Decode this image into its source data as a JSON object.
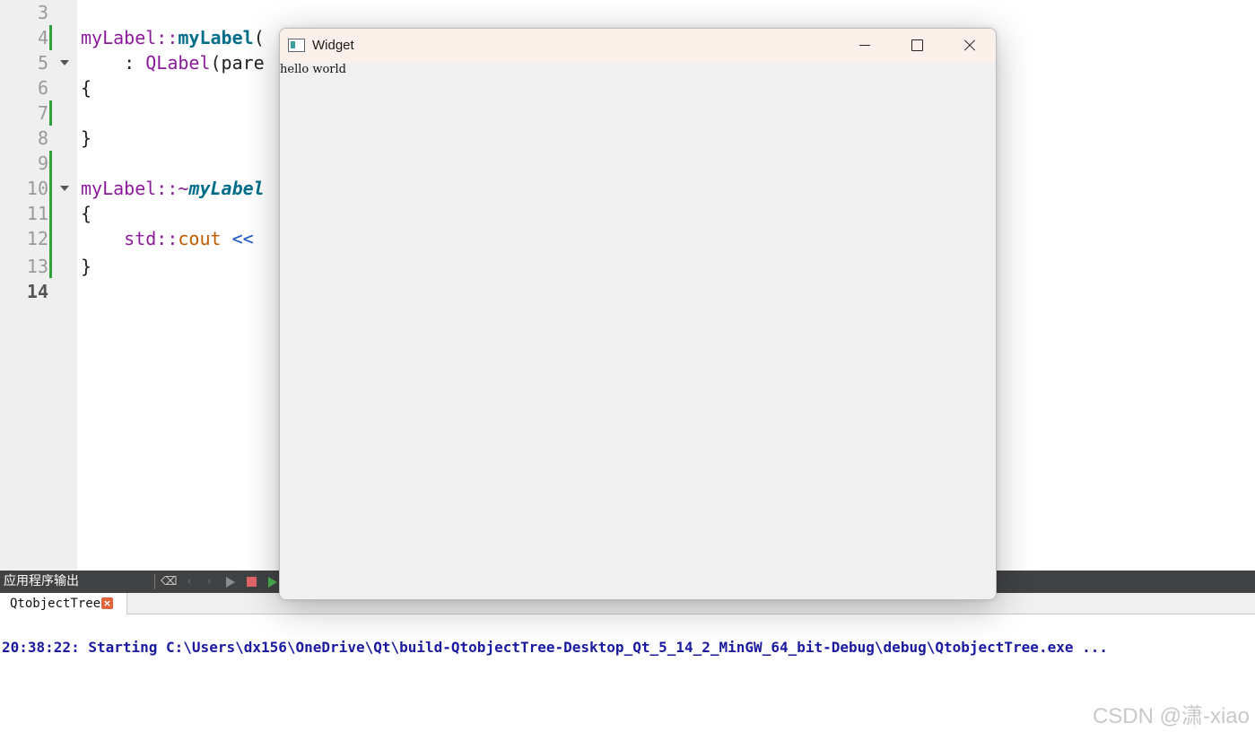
{
  "editor": {
    "line_numbers": [
      "3",
      "4",
      "5",
      "6",
      "7",
      "8",
      "9",
      "10",
      "11",
      "12",
      "13",
      "14"
    ],
    "code": {
      "l4_class": "myLabel",
      "l4_sep": "::",
      "l4_func": "myLabel",
      "l4_paren": "(",
      "l5_colon": "    : ",
      "l5_base": "QLabel",
      "l5_paren": "(",
      "l5_arg": "pare",
      "l6_brace": "{",
      "l8_brace": "}",
      "l10_class": "myLabel",
      "l10_sep": "::~",
      "l10_func": "myLabel",
      "l11_brace": "{",
      "l12_indent": "    ",
      "l12_ns": "std",
      "l12_sep": "::",
      "l12_obj": "cout",
      "l12_op": " <<",
      "l13_brace": "}"
    }
  },
  "output_pane": {
    "title": "应用程序输出",
    "toolbar_icons": [
      "clean-icon",
      "prev-icon",
      "next-icon",
      "run-icon",
      "stop-icon",
      "attach-run-icon"
    ],
    "tab_label": "QtobjectTree",
    "tab_close_glyph": "×",
    "log_line": "20:38:22: Starting C:\\Users\\dx156\\OneDrive\\Qt\\build-QtobjectTree-Desktop_Qt_5_14_2_MinGW_64_bit-Debug\\debug\\QtobjectTree.exe ..."
  },
  "widget_window": {
    "title": "Widget",
    "label_text": "hello world",
    "controls": [
      "minimize",
      "maximize",
      "close"
    ]
  },
  "watermark": "CSDN @潇-xiao",
  "colors": {
    "gutter_bg": "#efefef",
    "change_bar": "#2fa33a",
    "keyword_purple": "#8b1b9a",
    "function_teal": "#006e8a",
    "member_orange": "#c05a00",
    "operator_blue": "#1a56c8",
    "log_text": "#1a1aa0",
    "toolbar_bg": "#404244",
    "window_titlebar": "#fbf1ea",
    "window_body": "#f0f0f0"
  }
}
